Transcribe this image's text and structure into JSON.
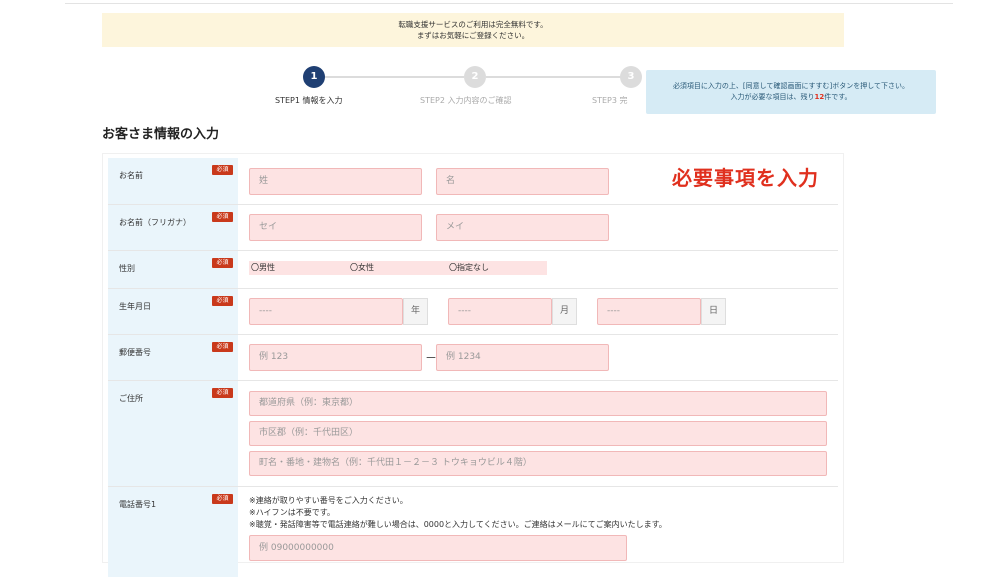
{
  "notice": {
    "line1": "転職支援サービスのご利用は完全無料です。",
    "line2": "まずはお気軽にご登録ください。"
  },
  "steps": [
    {
      "number": "1",
      "label": "STEP1 情報を入力"
    },
    {
      "number": "2",
      "label": "STEP2 入力内容のご確認"
    },
    {
      "number": "3",
      "label": "STEP3 完"
    }
  ],
  "tooltip": {
    "line1": "必須項目に入力の上、[同意して確認画面にすすむ]ボタンを押して下さい。",
    "line2_prefix": "入力が必要な項目は、残り",
    "count": "12",
    "line2_suffix": "件です。"
  },
  "section_title": "お客さま情報の入力",
  "overlay_text": "必要事項を入力",
  "required_badge": "必須",
  "form": {
    "name": {
      "label": "お名前",
      "last_placeholder": "姓",
      "first_placeholder": "名"
    },
    "kana": {
      "label": "お名前（フリガナ）",
      "last_placeholder": "セイ",
      "first_placeholder": "メイ"
    },
    "gender": {
      "label": "性別",
      "options": [
        "〇男性",
        "〇女性",
        "〇指定なし"
      ]
    },
    "birthdate": {
      "label": "生年月日",
      "year_value": "----",
      "year_unit": "年",
      "month_value": "----",
      "month_unit": "月",
      "day_value": "----",
      "day_unit": "日"
    },
    "postal": {
      "label": "郵便番号",
      "first_placeholder": "例 123",
      "dash": "－",
      "second_placeholder": "例 1234"
    },
    "address": {
      "label": "ご住所",
      "prefecture_placeholder": "都道府県（例：東京都）",
      "city_placeholder": "市区郡（例：千代田区）",
      "street_placeholder": "町名・番地・建物名（例：千代田１－２－３ トウキョウビル４階）"
    },
    "phone": {
      "label": "電話番号1",
      "note1": "※連絡が取りやすい番号をご入力ください。",
      "note2": "※ハイフンは不要です。",
      "note3": "※聴覚・発話障害等で電話連絡が難しい場合は、0000と入力してください。ご連絡はメールにてご案内いたします。",
      "placeholder": "例 09000000000"
    }
  },
  "colors": {
    "step_active": "#1f3f73",
    "step_inactive": "#dcdcdc",
    "required_badge": "#c9391b",
    "field_fill": "#fde3e3",
    "label_cell": "#eaf5fb",
    "overlay": "#e0301e"
  }
}
